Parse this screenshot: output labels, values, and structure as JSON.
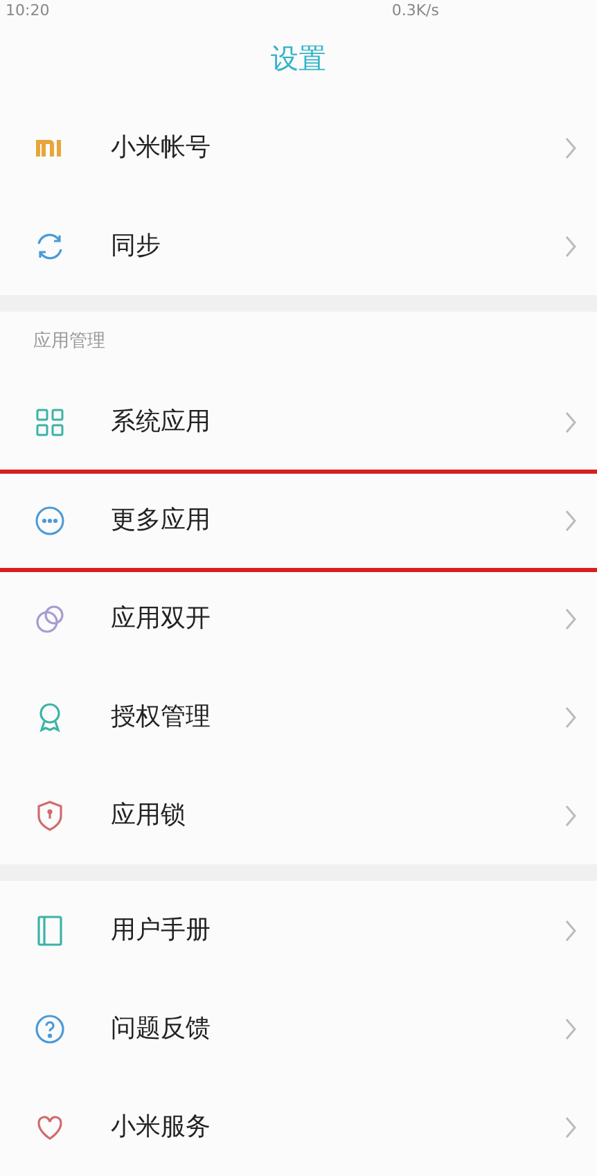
{
  "status_bar": {
    "time": "10:20",
    "speed": "0.3K/s"
  },
  "title": "设置",
  "groups": [
    {
      "items": [
        {
          "kind": "account",
          "label": "小米帐号",
          "highlighted": false
        },
        {
          "kind": "sync",
          "label": "同步",
          "highlighted": false
        }
      ]
    },
    {
      "header": "应用管理",
      "items": [
        {
          "kind": "grid",
          "label": "系统应用",
          "highlighted": false
        },
        {
          "kind": "more",
          "label": "更多应用",
          "highlighted": true
        },
        {
          "kind": "dual",
          "label": "应用双开",
          "highlighted": false
        },
        {
          "kind": "badge",
          "label": "授权管理",
          "highlighted": false
        },
        {
          "kind": "shield",
          "label": "应用锁",
          "highlighted": false
        }
      ]
    },
    {
      "items": [
        {
          "kind": "book",
          "label": "用户手册",
          "highlighted": false
        },
        {
          "kind": "question",
          "label": "问题反馈",
          "highlighted": false
        },
        {
          "kind": "heart",
          "label": "小米服务",
          "highlighted": false
        }
      ]
    }
  ]
}
